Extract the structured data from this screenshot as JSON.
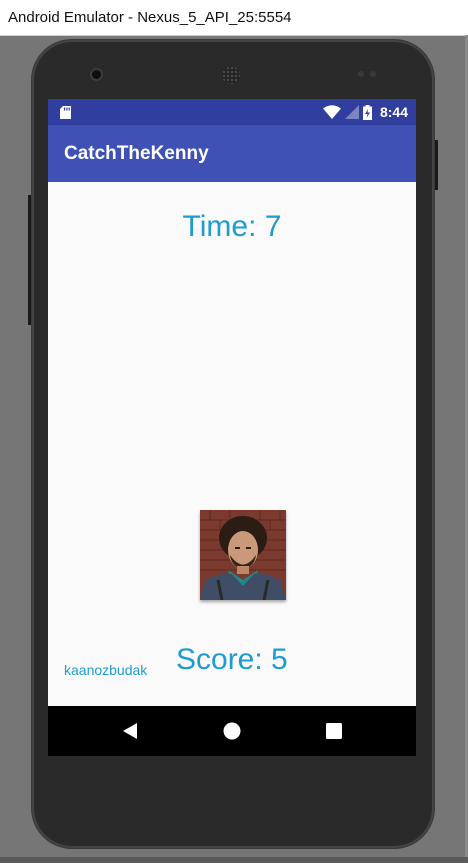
{
  "window": {
    "title": "Android Emulator - Nexus_5_API_25:5554"
  },
  "statusbar": {
    "time": "8:44",
    "icons": [
      "sd-card-icon",
      "wifi-icon",
      "signal-icon",
      "battery-charging-icon"
    ]
  },
  "appbar": {
    "title": "CatchTheKenny"
  },
  "game": {
    "time_label": "Time: 7",
    "score_label": "Score: 5",
    "author": "kaanozbudak",
    "target_image": "kenny-portrait"
  },
  "navbar": {
    "buttons": [
      "back-icon",
      "home-icon",
      "recents-icon"
    ]
  },
  "colors": {
    "statusbar": "#303f9f",
    "appbar": "#3f51b5",
    "accent_text": "#1e9bd0",
    "content_bg": "#fafafa"
  }
}
